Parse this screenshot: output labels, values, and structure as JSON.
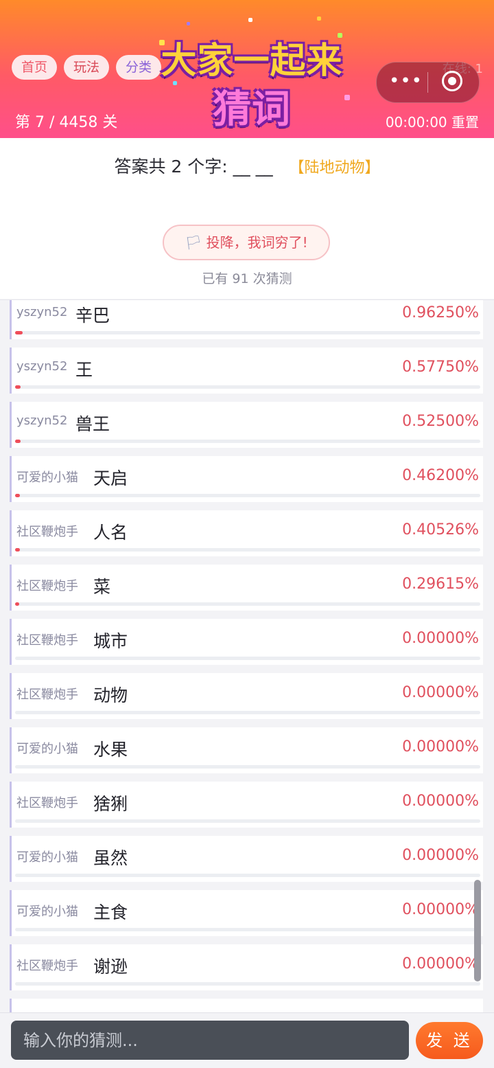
{
  "header": {
    "nav": [
      "首页",
      "玩法",
      "分类"
    ],
    "logo_line1": "大家一起来",
    "logo_line2": "猜词",
    "level": "第 7 / 4458 关",
    "timer": "00:00:00 重置",
    "online": "在线: 1",
    "capsule_more": "•••"
  },
  "question": {
    "prompt": "答案共 2 个字: __ __",
    "hint": "【陆地动物】",
    "surrender_flag": "🏳",
    "surrender": "投降，我词穷了!",
    "count": "已有 91 次猜测"
  },
  "guesses": [
    {
      "user": "yszyn52",
      "word": "辛巴",
      "pct": "0.96250%",
      "value": 0.9625
    },
    {
      "user": "yszyn52",
      "word": "王",
      "pct": "0.57750%",
      "value": 0.5775
    },
    {
      "user": "yszyn52",
      "word": "兽王",
      "pct": "0.52500%",
      "value": 0.525
    },
    {
      "user": "可爱的小猫",
      "word": "天启",
      "pct": "0.46200%",
      "value": 0.462
    },
    {
      "user": "社区鞭炮手",
      "word": "人名",
      "pct": "0.40526%",
      "value": 0.40526
    },
    {
      "user": "社区鞭炮手",
      "word": "菜",
      "pct": "0.29615%",
      "value": 0.29615
    },
    {
      "user": "社区鞭炮手",
      "word": "城市",
      "pct": "0.00000%",
      "value": 0
    },
    {
      "user": "社区鞭炮手",
      "word": "动物",
      "pct": "0.00000%",
      "value": 0
    },
    {
      "user": "可爱的小猫",
      "word": "水果",
      "pct": "0.00000%",
      "value": 0
    },
    {
      "user": "社区鞭炮手",
      "word": "猞猁",
      "pct": "0.00000%",
      "value": 0
    },
    {
      "user": "可爱的小猫",
      "word": "虽然",
      "pct": "0.00000%",
      "value": 0
    },
    {
      "user": "可爱的小猫",
      "word": "主食",
      "pct": "0.00000%",
      "value": 0
    },
    {
      "user": "社区鞭炮手",
      "word": "谢逊",
      "pct": "0.00000%",
      "value": 0
    }
  ],
  "input": {
    "placeholder": "输入你的猜测...",
    "send": "发 送"
  },
  "colors": {
    "accent": "#ef4e5a",
    "hint": "#f0a81e",
    "send": "#f65a1d"
  }
}
